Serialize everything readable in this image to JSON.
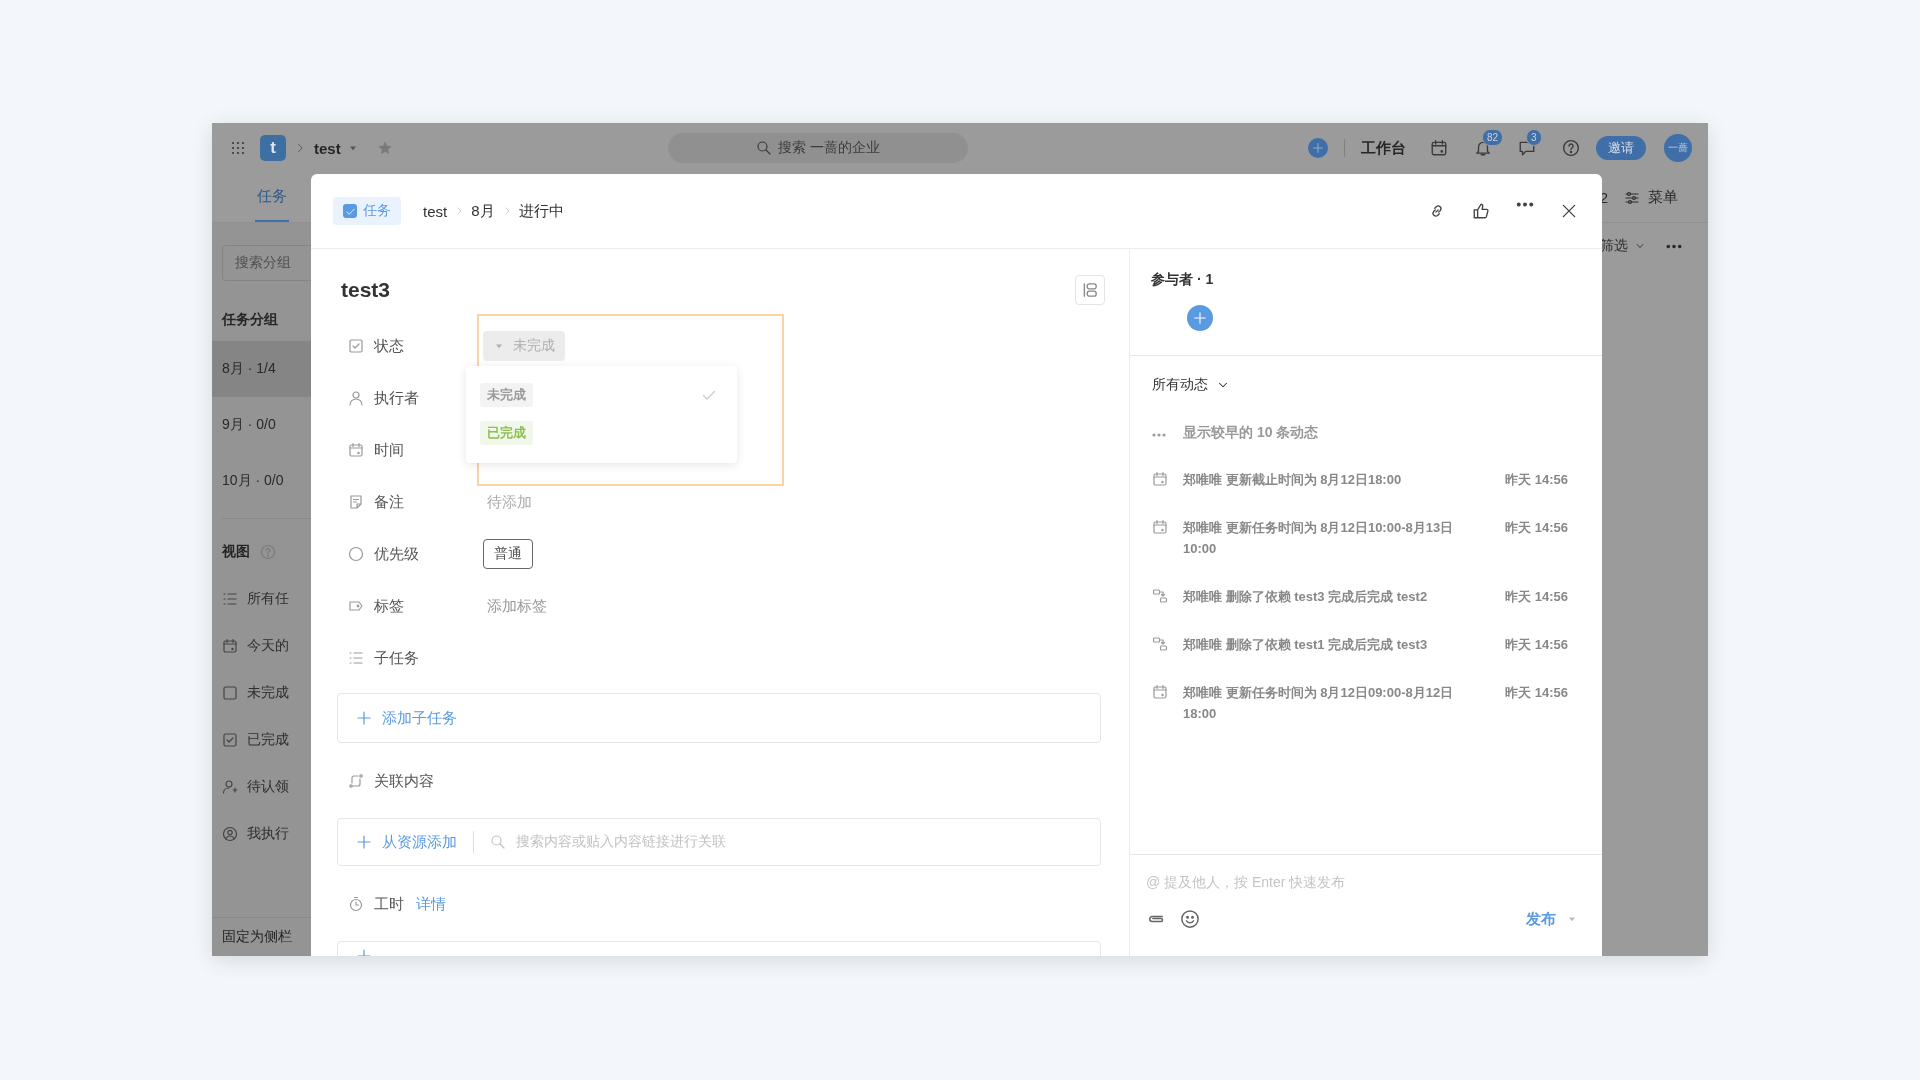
{
  "app": {
    "topbar": {
      "logo": "t",
      "project": "test",
      "search_placeholder": "搜索 一蔷的企业",
      "workbench": "工作台",
      "notification_count": "82",
      "message_count": "3",
      "invite": "邀请",
      "avatar": "一蔷"
    },
    "tabs": [
      {
        "label": "任务",
        "selected": true
      }
    ],
    "toolbar": {
      "count": "2",
      "menu": "菜单",
      "filter": "筛选"
    },
    "sidebar": {
      "search_placeholder": "搜索分组",
      "groups_title": "任务分组",
      "groups": [
        {
          "label": "8月 · 1/4",
          "selected": true
        },
        {
          "label": "9月 · 0/0",
          "selected": false
        },
        {
          "label": "10月 · 0/0",
          "selected": false
        }
      ],
      "views_title": "视图",
      "views": [
        {
          "label": "所有任"
        },
        {
          "label": "今天的"
        },
        {
          "label": "未完成"
        },
        {
          "label": "已完成"
        },
        {
          "label": "待认领"
        },
        {
          "label": "我执行"
        }
      ],
      "footer": "固定为侧栏"
    }
  },
  "modal": {
    "type_tag": "任务",
    "breadcrumb": [
      "test",
      "8月",
      "进行中"
    ],
    "title": "test3",
    "fields": [
      {
        "label": "状态",
        "kind": "status",
        "value": "未完成"
      },
      {
        "label": "执行者",
        "kind": "empty"
      },
      {
        "label": "时间",
        "kind": "empty"
      },
      {
        "label": "备注",
        "kind": "text",
        "placeholder": "待添加"
      },
      {
        "label": "优先级",
        "kind": "tag",
        "value": "普通"
      },
      {
        "label": "标签",
        "kind": "text",
        "placeholder": "添加标签"
      },
      {
        "label": "子任务",
        "kind": "empty"
      }
    ],
    "status_options": [
      {
        "label": "未完成",
        "selected": true,
        "color": "#9a9a9a"
      },
      {
        "label": "已完成",
        "selected": false,
        "color": "#8cc152"
      }
    ],
    "add_subtask": "添加子任务",
    "related_title": "关联内容",
    "add_from_resource": "从资源添加",
    "related_search_placeholder": "搜索内容或贴入内容链接进行关联",
    "worktime_title": "工时",
    "worktime_link": "详情",
    "participants_title": "参与者 · 1",
    "activity_filter": "所有动态",
    "show_earlier": "显示较早的 10 条动态",
    "activities": [
      {
        "kind": "time",
        "text": "郑唯唯 更新截止时间为 8月12日18:00",
        "time": "昨天 14:56"
      },
      {
        "kind": "time",
        "text": "郑唯唯 更新任务时间为 8月12日10:00-8月13日 10:00",
        "time": "昨天 14:56"
      },
      {
        "kind": "dependency",
        "text": "郑唯唯 删除了依赖 test3 完成后完成 test2",
        "time": "昨天 14:56"
      },
      {
        "kind": "dependency",
        "text": "郑唯唯 删除了依赖 test1 完成后完成 test3",
        "time": "昨天 14:56"
      },
      {
        "kind": "time",
        "text": "郑唯唯 更新任务时间为 8月12日09:00-8月12日 18:00",
        "time": "昨天 14:56"
      }
    ],
    "comment_placeholder": "@ 提及他人，按 Enter 快速发布",
    "publish": "发布"
  }
}
